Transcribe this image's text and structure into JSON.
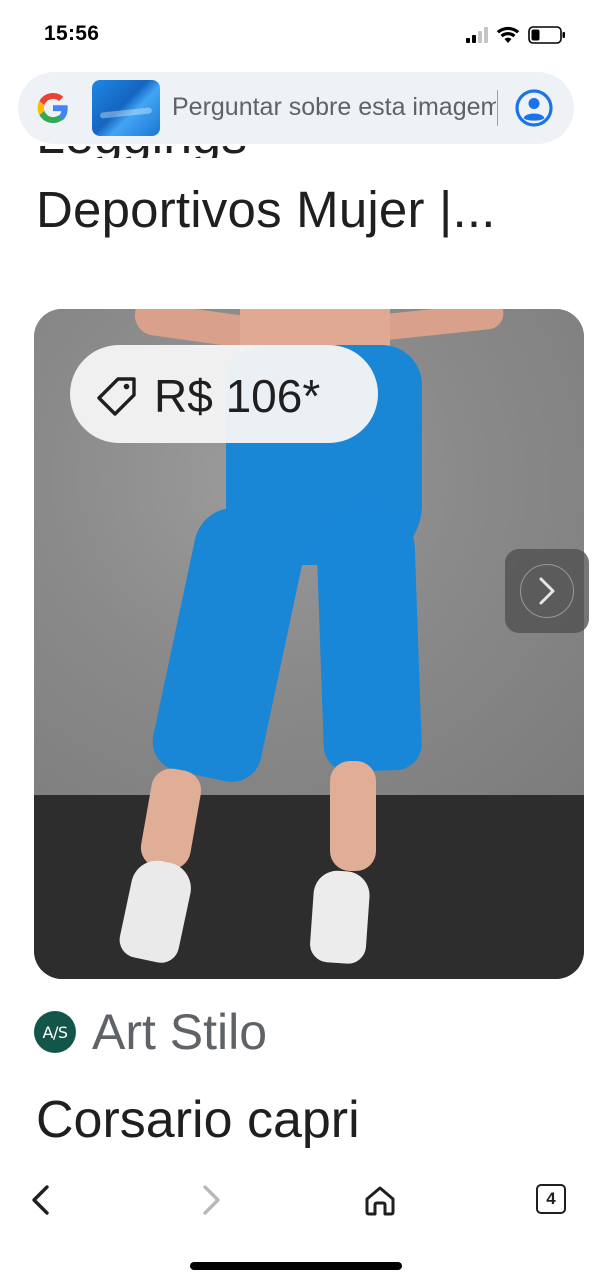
{
  "status_bar": {
    "time": "15:56"
  },
  "search": {
    "placeholder": "Perguntar sobre esta imagem"
  },
  "result": {
    "title_line_partial": "Leggings",
    "title": "Deportivos Mujer |...",
    "price": "R$ 106*",
    "seller_logo_text": "A/S",
    "seller_name": "Art Stilo",
    "product_name": "Corsario capri"
  },
  "toolbar": {
    "tabs_count": "4"
  },
  "icons": {
    "google": "google-logo-icon",
    "account": "account-circle-icon",
    "tag": "price-tag-icon",
    "next": "chevron-right-icon",
    "back": "chevron-left-icon",
    "forward": "chevron-right-icon",
    "home": "home-icon",
    "tabs": "tabs-icon"
  },
  "colors": {
    "search_bg": "#eef2f6",
    "account_blue": "#1a73e8",
    "legging_blue": "#1a86d6",
    "seller_logo_bg": "#14554a"
  }
}
